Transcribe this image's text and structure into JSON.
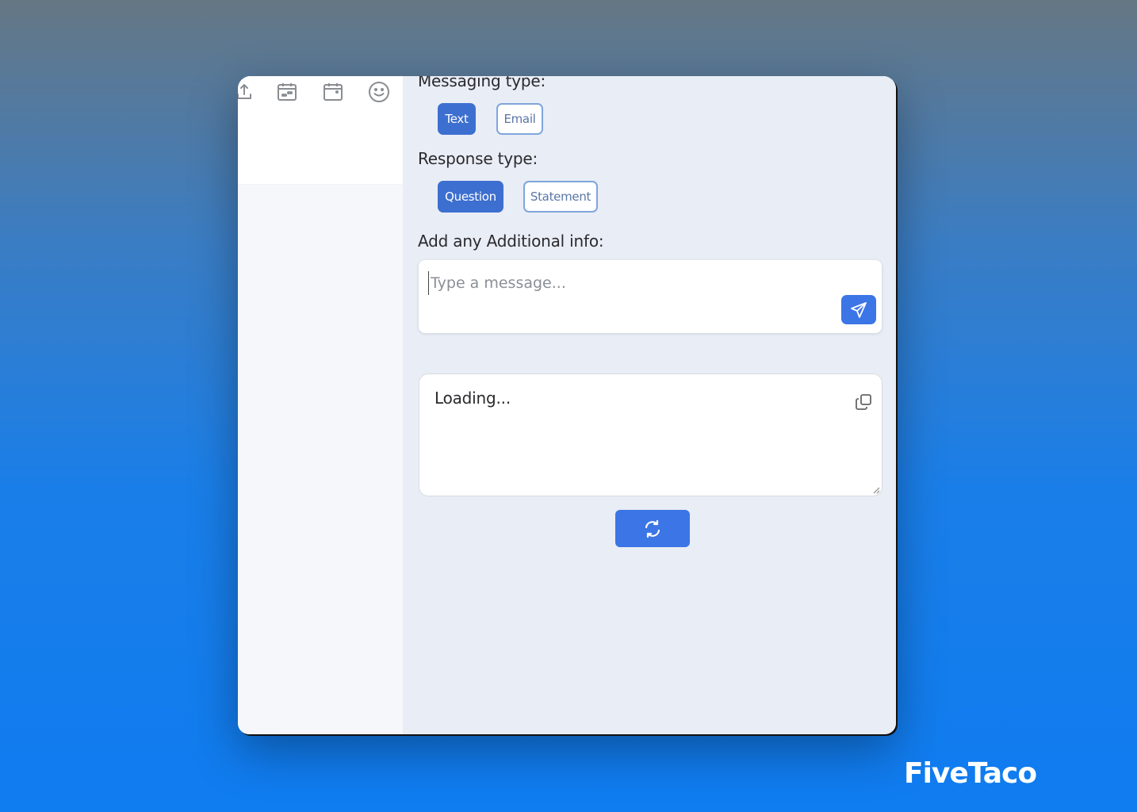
{
  "toolbar": {
    "icons": [
      "upload-icon",
      "calendar-dots-icon",
      "calendar-icon",
      "emoji-icon"
    ]
  },
  "form": {
    "messaging_type": {
      "label": "Messaging type:",
      "options": [
        {
          "label": "Text",
          "selected": true
        },
        {
          "label": "Email",
          "selected": false
        }
      ]
    },
    "response_type": {
      "label": "Response type:",
      "options": [
        {
          "label": "Question",
          "selected": true
        },
        {
          "label": "Statement",
          "selected": false
        }
      ]
    },
    "additional_info": {
      "label": "Add any Additional info:",
      "placeholder": "Type a message...",
      "value": ""
    }
  },
  "result": {
    "text": "Loading..."
  },
  "colors": {
    "accent": "#3b75e6",
    "chip_active": "#3d6fd0",
    "chip_inactive_border": "#7fa6dd"
  },
  "brand": {
    "name": "FiveTaco"
  }
}
